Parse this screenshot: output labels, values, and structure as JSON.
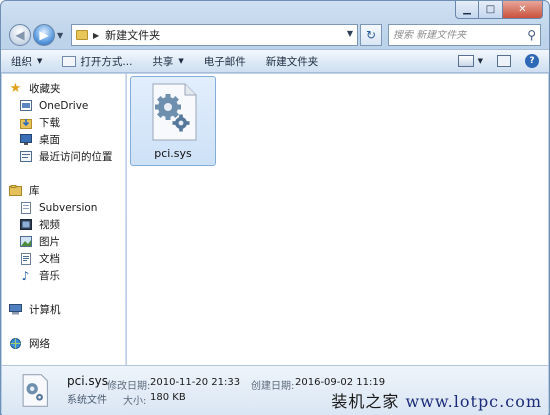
{
  "address": {
    "path": "新建文件夹"
  },
  "search": {
    "placeholder": "搜索 新建文件夹"
  },
  "toolbar": {
    "organize": "组织",
    "open_with": "打开方式...",
    "share": "共享",
    "email": "电子邮件",
    "new_folder": "新建文件夹"
  },
  "nav": {
    "favorites": {
      "label": "收藏夹",
      "items": [
        "OneDrive",
        "下载",
        "桌面",
        "最近访问的位置"
      ]
    },
    "libraries": {
      "label": "库",
      "items": [
        "Subversion",
        "视频",
        "图片",
        "文档",
        "音乐"
      ]
    },
    "computer": "计算机",
    "network": "网络"
  },
  "files": [
    {
      "name": "pci.sys",
      "icon": "system-file-gear-icon"
    }
  ],
  "details": {
    "name": "pci.sys",
    "type": "系统文件",
    "modified_label": "修改日期:",
    "modified_value": "2010-11-20 21:33",
    "size_label": "大小:",
    "size_value": "180 KB",
    "created_label": "创建日期:",
    "created_value": "2016-09-02 11:19"
  },
  "watermark": {
    "text": "装机之家",
    "url": "www.lotpc.com"
  },
  "colors": {
    "accent": "#2e69b8",
    "selection": "#cde1f7",
    "chrome": "#bcd3ea"
  }
}
